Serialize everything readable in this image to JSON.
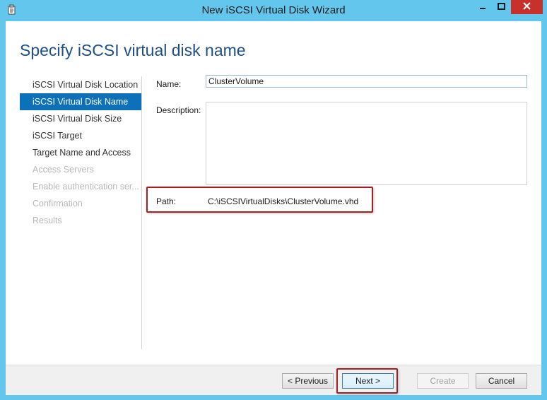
{
  "window": {
    "title": "New iSCSI Virtual Disk Wizard",
    "icons": {
      "app": "wizard-app-icon",
      "minimize": "minimize-icon",
      "maximize": "maximize-icon",
      "close": "close-icon"
    }
  },
  "page": {
    "heading": "Specify iSCSI virtual disk name"
  },
  "steps": [
    {
      "label": "iSCSI Virtual Disk Location",
      "state": "normal"
    },
    {
      "label": "iSCSI Virtual Disk Name",
      "state": "active"
    },
    {
      "label": "iSCSI Virtual Disk Size",
      "state": "normal"
    },
    {
      "label": "iSCSI Target",
      "state": "normal"
    },
    {
      "label": "Target Name and Access",
      "state": "normal"
    },
    {
      "label": "Access Servers",
      "state": "disabled"
    },
    {
      "label": "Enable authentication ser...",
      "state": "disabled"
    },
    {
      "label": "Confirmation",
      "state": "disabled"
    },
    {
      "label": "Results",
      "state": "disabled"
    }
  ],
  "form": {
    "name_label": "Name:",
    "name_value": "ClusterVolume",
    "description_label": "Description:",
    "description_value": "",
    "path_label": "Path:",
    "path_value": "C:\\iSCSIVirtualDisks\\ClusterVolume.vhd"
  },
  "buttons": {
    "previous": "< Previous",
    "next": "Next >",
    "create": "Create",
    "cancel": "Cancel"
  },
  "colors": {
    "titlebar": "#63c6ec",
    "heading": "#1e4f86",
    "active_step": "#0d71b9",
    "highlight": "#a32025",
    "close_button": "#c7302b"
  }
}
